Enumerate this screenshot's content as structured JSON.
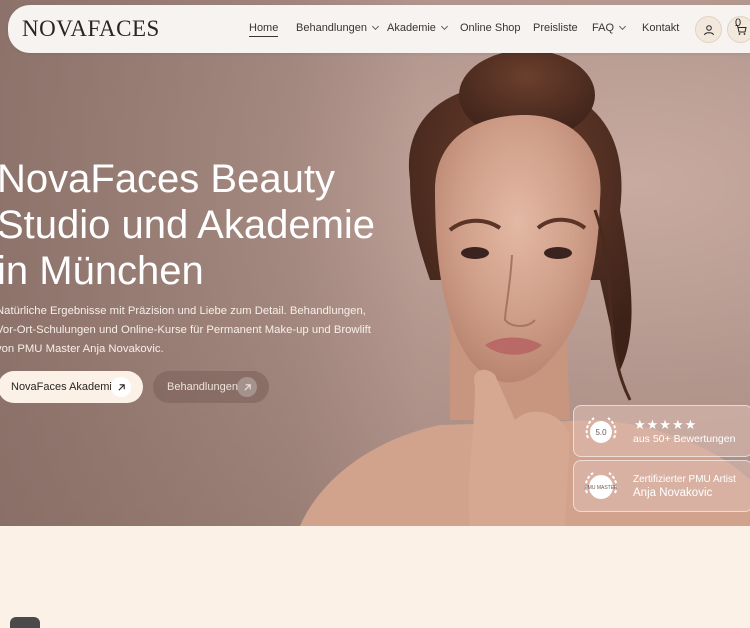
{
  "brand": {
    "logo": "NOVAFACES"
  },
  "nav": {
    "items": [
      {
        "label": "Home",
        "active": true,
        "dropdown": false
      },
      {
        "label": "Behandlungen",
        "active": false,
        "dropdown": true
      },
      {
        "label": "Akademie",
        "active": false,
        "dropdown": true
      },
      {
        "label": "Online Shop",
        "active": false,
        "dropdown": false
      },
      {
        "label": "Preisliste",
        "active": false,
        "dropdown": false
      },
      {
        "label": "FAQ",
        "active": false,
        "dropdown": true
      },
      {
        "label": "Kontakt",
        "active": false,
        "dropdown": false
      }
    ],
    "account_icon": "user-icon",
    "cart_icon": "cart-icon",
    "cart_count": "0"
  },
  "hero": {
    "title_lines": [
      "NovaFaces Beauty",
      "Studio und Akademie",
      "in München"
    ],
    "subtitle": "Natürliche Ergebnisse mit Präzision und Liebe zum Detail. Behandlungen, Vor-Ort-Schulungen und Online-Kurse für Permanent Make-up und Browlift von PMU Master Anja Novakovic.",
    "primary_button": "NovaFaces Akademie",
    "secondary_button": "Behandlungen"
  },
  "badges": {
    "rating": {
      "seal": "5.0",
      "stars": "★★★★★",
      "text": "aus 50+ Bewertungen"
    },
    "certified": {
      "seal": "PMU MASTER",
      "line1": "Zertifizierter PMU Artist",
      "line2": "Anja Novakovic"
    }
  },
  "colors": {
    "cream": "#fbf1e7",
    "hero_bg": "#b3978e",
    "text_dark": "#2a2422"
  }
}
